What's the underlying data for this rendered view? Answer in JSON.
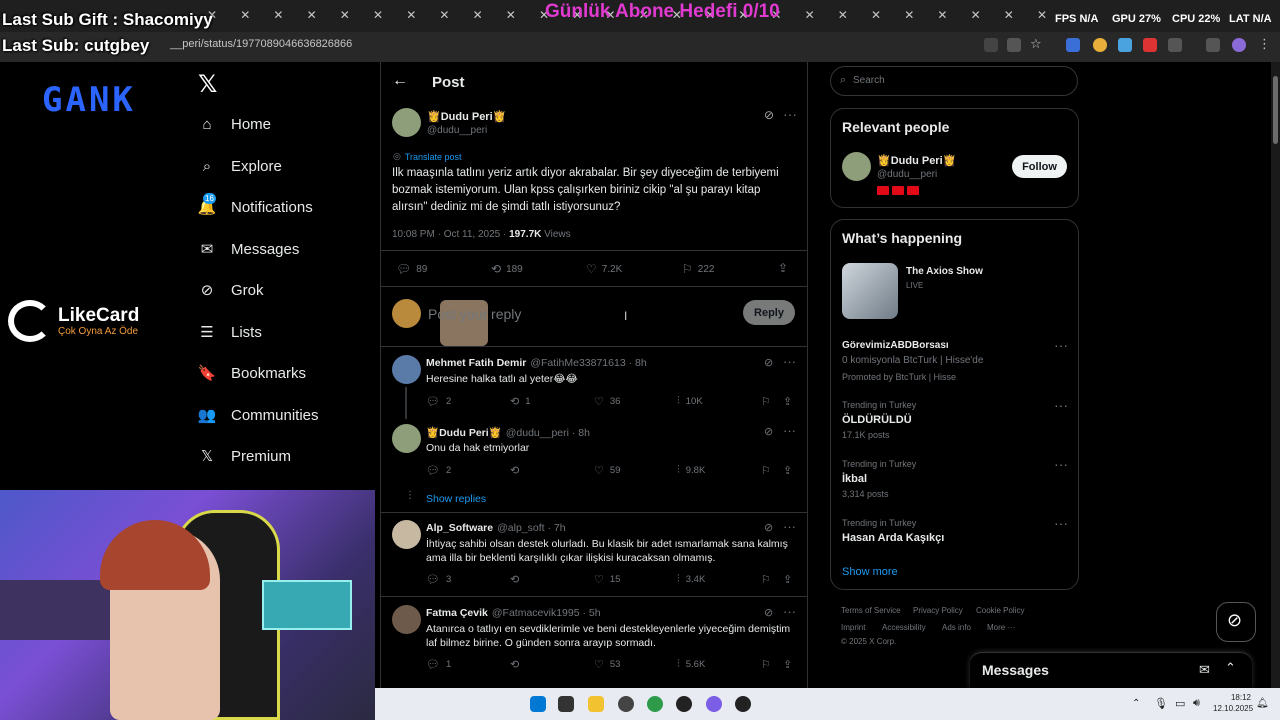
{
  "overlay": {
    "last_sub_gift": "Last Sub Gift : Shacomiyy",
    "last_sub": "Last Sub: cutgbey",
    "goal": "Günlük Abone Hedefi 0/10",
    "fps": "FPS N/A",
    "gpu": "GPU 27%",
    "cpu": "CPU 22%",
    "lat": "LAT N/A"
  },
  "browser": {
    "url": "__peri/status/1977089046636826866"
  },
  "sidebar": {
    "items": [
      {
        "label": "Home",
        "icon": "home-icon",
        "glyph": "⌂"
      },
      {
        "label": "Explore",
        "icon": "search-icon",
        "glyph": "⌕"
      },
      {
        "label": "Notifications",
        "icon": "bell-icon",
        "glyph": "🔔"
      },
      {
        "label": "Messages",
        "icon": "envelope-icon",
        "glyph": "✉"
      },
      {
        "label": "Grok",
        "icon": "grok-icon",
        "glyph": "⊘"
      },
      {
        "label": "Lists",
        "icon": "list-icon",
        "glyph": "☰"
      },
      {
        "label": "Bookmarks",
        "icon": "bookmark-icon",
        "glyph": "🔖"
      },
      {
        "label": "Communities",
        "icon": "communities-icon",
        "glyph": "👥"
      },
      {
        "label": "Premium",
        "icon": "x-icon",
        "glyph": "𝕏"
      }
    ],
    "notification_count": "16"
  },
  "likecard": {
    "name": "LikeCard",
    "tagline": "Çok Oyna  Az Öde"
  },
  "post": {
    "header": "Post",
    "author_name": "👸Dudu Peri👸",
    "author_handle": "@dudu__peri",
    "translate": "Translate post",
    "text": "Ilk maaşınla tatlını yeriz artık diyor akrabalar. Bir şey diyeceğim de terbiyemi bozmak istemiyorum. Ulan kpss çalışırken biriniz cikip \"al şu parayı kitap alırsın\" dediniz mi de şimdi tatlı istiyorsunuz?",
    "time": "10:08 PM · Oct 11, 2025 · ",
    "views_count": "197.7K",
    "views_label": " Views",
    "replies": "89",
    "reposts": "189",
    "likes": "7.2K",
    "bookmarks": "222",
    "reply_placeholder": "Post your reply",
    "reply_button": "Reply"
  },
  "replies": [
    {
      "name": "Mehmet Fatih Demir",
      "handle": "@FatihMe33871613 · 8h",
      "text": "Heresine halka tatlı al yeter😂😂",
      "replies": "2",
      "reposts": "1",
      "likes": "36",
      "views": "10K"
    },
    {
      "name": "👸Dudu Peri👸",
      "handle": "@dudu__peri · 8h",
      "text": "Onu da hak etmiyorlar",
      "replies": "2",
      "reposts": "",
      "likes": "59",
      "views": "9.8K",
      "show_replies": "Show replies"
    },
    {
      "name": "Alp_Software",
      "handle": "@alp_soft · 7h",
      "text": "İhtiyaç sahibi olsan destek olurladı. Bu klasik bir adet ısmarlamak sana kalmış ama illa bir beklenti karşılıklı çıkar ilişkisi kuracaksan olmamış.",
      "replies": "3",
      "reposts": "",
      "likes": "15",
      "views": "3.4K"
    },
    {
      "name": "Fatma Çevik",
      "handle": "@Fatmacevik1995 · 5h",
      "text": "Atanırca o tatlıyı en sevdiklerimle ve beni destekleyenlerle yiyeceğim demiştim laf bilmez birine. O günden sonra arayıp sormadı.",
      "replies": "1",
      "reposts": "",
      "likes": "53",
      "views": "5.6K"
    }
  ],
  "right": {
    "search_placeholder": "Search",
    "relevant_title": "Relevant people",
    "relevant_name": "👸Dudu Peri👸",
    "relevant_handle": "@dudu__peri",
    "follow": "Follow",
    "happening_title": "What’s happening",
    "live_title": "The Axios Show",
    "live_label": "LIVE",
    "promo_title": "GörevimizABDBorsası",
    "promo_desc": "0 komisyonla BtcTurk | Hisse'de",
    "promo_by": "Promoted by BtcTurk | Hisse",
    "trends": [
      {
        "context": "Trending in Turkey",
        "topic": "ÖLDÜRÜLDÜ",
        "posts": "17.1K posts"
      },
      {
        "context": "Trending in Turkey",
        "topic": "İkbal",
        "posts": "3,314 posts"
      },
      {
        "context": "Trending in Turkey",
        "topic": "Hasan Arda Kaşıkçı",
        "posts": ""
      }
    ],
    "show_more": "Show more",
    "footer": {
      "terms": "Terms of Service",
      "privacy": "Privacy Policy",
      "cookie": "Cookie Policy",
      "imprint": "Imprint",
      "access": "Accessibility",
      "ads": "Ads info",
      "more": "More ···",
      "copy": "© 2025 X Corp."
    },
    "messages": "Messages"
  },
  "taskbar": {
    "time": "18:12",
    "date": "12.10.2025"
  }
}
